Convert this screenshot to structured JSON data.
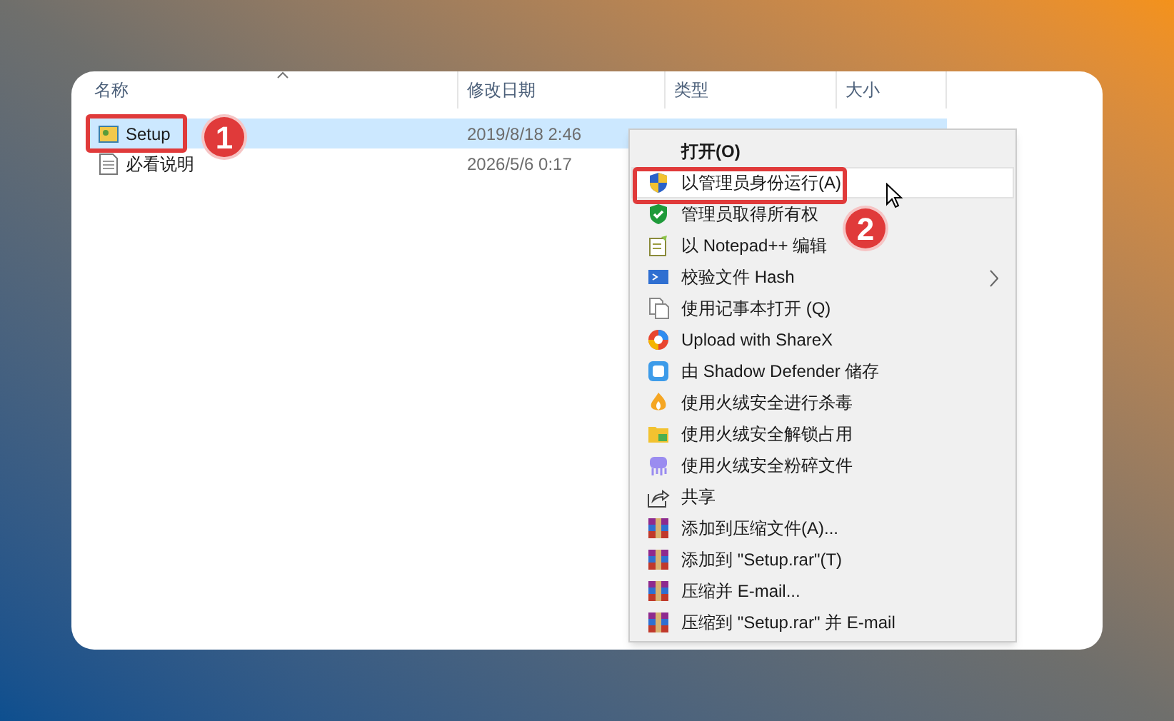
{
  "columns": [
    {
      "label": "名称"
    },
    {
      "label": "修改日期"
    },
    {
      "label": "类型"
    },
    {
      "label": "大小"
    }
  ],
  "rows": [
    {
      "name": "Setup",
      "date": "2019/8/18 2:46",
      "selected": true
    },
    {
      "name": "必看说明",
      "date": "2026/5/6 0:17",
      "selected": false
    }
  ],
  "context_menu": {
    "items": [
      {
        "label": "打开(O)",
        "default": true,
        "highlighted": false,
        "submenu": false
      },
      {
        "label": "以管理员身份运行(A)",
        "default": false,
        "highlighted": true,
        "submenu": false
      },
      {
        "label": "管理员取得所有权",
        "default": false,
        "highlighted": false,
        "submenu": false
      },
      {
        "label": "以 Notepad++ 编辑",
        "default": false,
        "highlighted": false,
        "submenu": false
      },
      {
        "label": "校验文件 Hash",
        "default": false,
        "highlighted": false,
        "submenu": true
      },
      {
        "label": "使用记事本打开 (Q)",
        "default": false,
        "highlighted": false,
        "submenu": false
      },
      {
        "label": "Upload with ShareX",
        "default": false,
        "highlighted": false,
        "submenu": false
      },
      {
        "label": "由 Shadow Defender 储存",
        "default": false,
        "highlighted": false,
        "submenu": false
      },
      {
        "label": "使用火绒安全进行杀毒",
        "default": false,
        "highlighted": false,
        "submenu": false
      },
      {
        "label": "使用火绒安全解锁占用",
        "default": false,
        "highlighted": false,
        "submenu": false
      },
      {
        "label": "使用火绒安全粉碎文件",
        "default": false,
        "highlighted": false,
        "submenu": false
      },
      {
        "label": "共享",
        "default": false,
        "highlighted": false,
        "submenu": false
      },
      {
        "label": "添加到压缩文件(A)...",
        "default": false,
        "highlighted": false,
        "submenu": false
      },
      {
        "label": "添加到 \"Setup.rar\"(T)",
        "default": false,
        "highlighted": false,
        "submenu": false
      },
      {
        "label": "压缩并 E-mail...",
        "default": false,
        "highlighted": false,
        "submenu": false
      },
      {
        "label": "压缩到 \"Setup.rar\" 并 E-mail",
        "default": false,
        "highlighted": false,
        "submenu": false
      }
    ]
  },
  "callouts": [
    {
      "number": "1"
    },
    {
      "number": "2"
    }
  ]
}
